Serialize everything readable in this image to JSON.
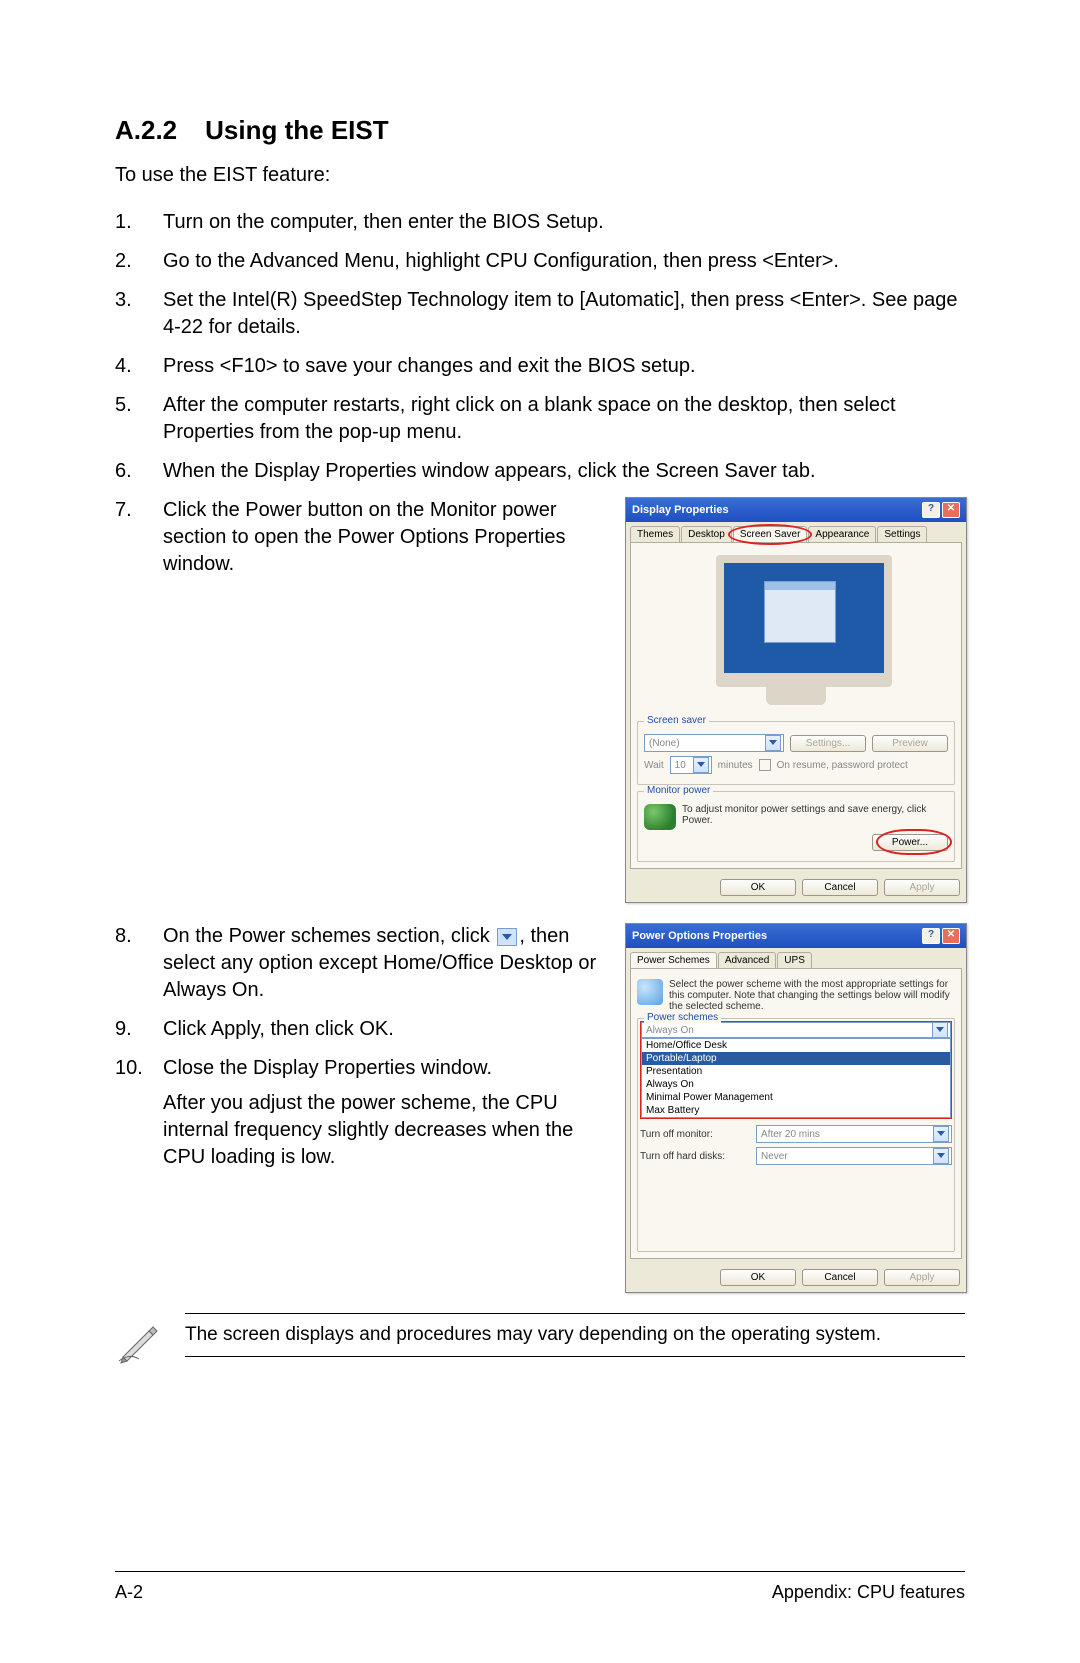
{
  "heading": {
    "number": "A.2.2",
    "title": "Using the EIST"
  },
  "intro": "To use the EIST feature:",
  "steps": {
    "s1": "Turn on the computer, then enter the BIOS Setup.",
    "s2": "Go to the Advanced Menu, highlight CPU Configuration, then press <Enter>.",
    "s3": "Set the Intel(R) SpeedStep Technology item to [Automatic], then press <Enter>. See page 4-22 for details.",
    "s4": "Press <F10> to save your changes and exit the BIOS setup.",
    "s5": "After the computer restarts, right click on a blank space on the desktop, then select Properties from the pop-up menu.",
    "s6": "When the Display Properties window appears, click the Screen Saver tab.",
    "s7": "Click the Power button on the Monitor power section to open the Power Options Properties window.",
    "s8a": "On the Power schemes section, click ",
    "s8b": ", then select any option except Home/Office Desktop or Always On.",
    "s9": "Click Apply, then click OK.",
    "s10": "Close the Display Properties window.",
    "s10_after": "After you adjust the power scheme, the CPU internal frequency slightly decreases when the CPU loading is low."
  },
  "note": "The screen displays and procedures may vary depending on the operating system.",
  "footer": {
    "left": "A-2",
    "right": "Appendix: CPU features"
  },
  "dlg1": {
    "title": "Display Properties",
    "tabs": {
      "themes": "Themes",
      "desktop": "Desktop",
      "screensaver": "Screen Saver",
      "appearance": "Appearance",
      "settings": "Settings"
    },
    "grp_ss": "Screen saver",
    "ss_value": "(None)",
    "btn_settings": "Settings...",
    "btn_preview": "Preview",
    "wait": "Wait",
    "wait_val": "10",
    "wait_unit": "minutes",
    "resume": "On resume, password protect",
    "grp_mon": "Monitor power",
    "mon_text": "To adjust monitor power settings and save energy, click Power.",
    "btn_power": "Power...",
    "ok": "OK",
    "cancel": "Cancel",
    "apply": "Apply"
  },
  "dlg2": {
    "title": "Power Options Properties",
    "tabs": {
      "ps": "Power Schemes",
      "adv": "Advanced",
      "ups": "UPS"
    },
    "desc": "Select the power scheme with the most appropriate settings for this computer. Note that changing the settings below will modify the selected scheme.",
    "grp_ps": "Power schemes",
    "selected": "Always On",
    "options": {
      "o1": "Home/Office Desk",
      "o2": "Portable/Laptop",
      "o3": "Presentation",
      "o4": "Always On",
      "o5": "Minimal Power Management",
      "o6": "Max Battery"
    },
    "turnoff_mon_label": "Turn off monitor:",
    "turnoff_mon_val": "After 20 mins",
    "turnoff_hd_label": "Turn off hard disks:",
    "turnoff_hd_val": "Never",
    "ok": "OK",
    "cancel": "Cancel",
    "apply": "Apply"
  }
}
